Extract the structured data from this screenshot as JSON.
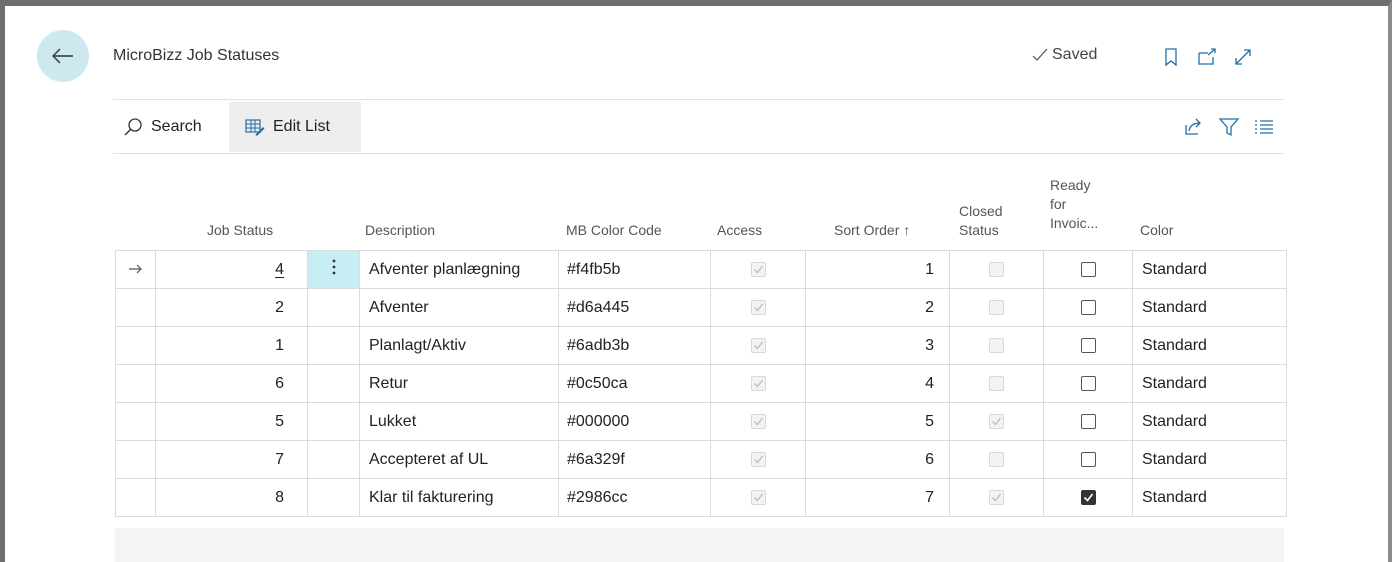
{
  "page": {
    "title": "MicroBizz Job Statuses",
    "saved_label": "Saved"
  },
  "header_icons": [
    "back-arrow-icon",
    "bookmark-icon",
    "open-new-window-icon",
    "expand-icon"
  ],
  "action_bar": {
    "search_label": "Search",
    "edit_list_label": "Edit List",
    "right_icons": [
      "share-icon",
      "filter-icon",
      "list-view-icon"
    ]
  },
  "columns": {
    "job_status": "Job Status",
    "description": "Description",
    "mb_color_code": "MB Color Code",
    "access": "Access",
    "sort_order": "Sort Order",
    "sort_indicator": "↑",
    "closed_status_1": "Closed",
    "closed_status_2": "Status",
    "ready_1": "Ready",
    "ready_2": "for",
    "ready_3": "Invoic...",
    "color": "Color"
  },
  "rows": [
    {
      "job_status": "4",
      "description": "Afventer planlægning",
      "mb_color_code": "#f4fb5b",
      "access": true,
      "sort_order": "1",
      "closed_status": false,
      "ready_for_invoicing": false,
      "color": "Standard"
    },
    {
      "job_status": "2",
      "description": "Afventer",
      "mb_color_code": "#d6a445",
      "access": true,
      "sort_order": "2",
      "closed_status": false,
      "ready_for_invoicing": false,
      "color": "Standard"
    },
    {
      "job_status": "1",
      "description": "Planlagt/Aktiv",
      "mb_color_code": "#6adb3b",
      "access": true,
      "sort_order": "3",
      "closed_status": false,
      "ready_for_invoicing": false,
      "color": "Standard"
    },
    {
      "job_status": "6",
      "description": "Retur",
      "mb_color_code": "#0c50ca",
      "access": true,
      "sort_order": "4",
      "closed_status": false,
      "ready_for_invoicing": false,
      "color": "Standard"
    },
    {
      "job_status": "5",
      "description": "Lukket",
      "mb_color_code": "#000000",
      "access": true,
      "sort_order": "5",
      "closed_status": true,
      "ready_for_invoicing": false,
      "color": "Standard"
    },
    {
      "job_status": "7",
      "description": "Accepteret af UL",
      "mb_color_code": "#6a329f",
      "access": true,
      "sort_order": "6",
      "closed_status": false,
      "ready_for_invoicing": false,
      "color": "Standard"
    },
    {
      "job_status": "8",
      "description": "Klar til fakturering",
      "mb_color_code": "#2986cc",
      "access": true,
      "sort_order": "7",
      "closed_status": true,
      "ready_for_invoicing": true,
      "color": "Standard"
    }
  ],
  "colors": {
    "accent": "#cde9ef",
    "selected_cell": "#c7eef3"
  }
}
